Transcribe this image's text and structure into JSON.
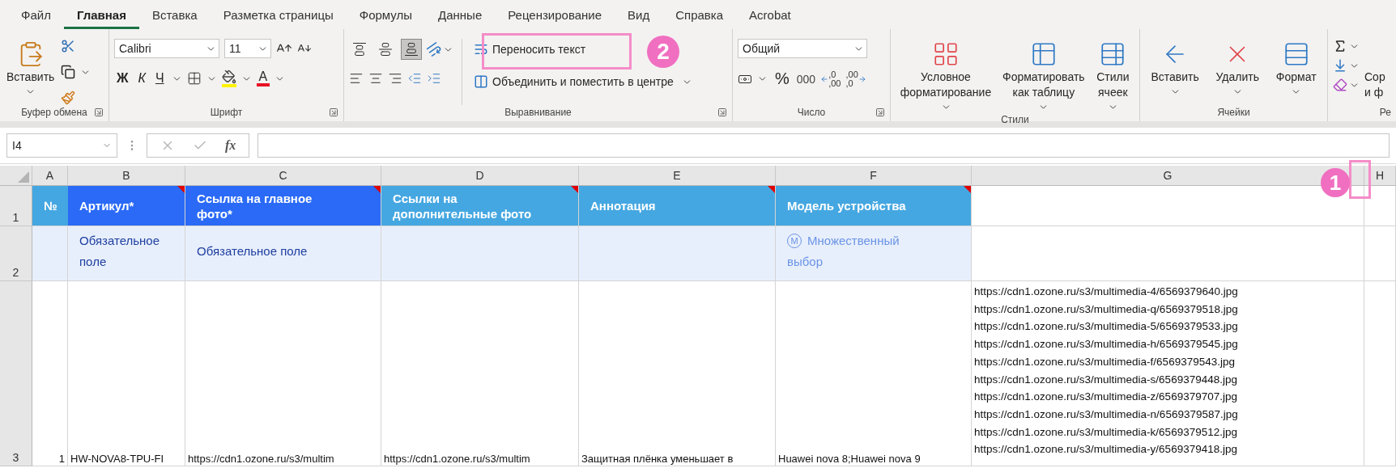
{
  "menu_tabs": [
    {
      "label": "Файл",
      "selected": false
    },
    {
      "label": "Главная",
      "selected": true
    },
    {
      "label": "Вставка",
      "selected": false
    },
    {
      "label": "Разметка страницы",
      "selected": false
    },
    {
      "label": "Формулы",
      "selected": false
    },
    {
      "label": "Данные",
      "selected": false
    },
    {
      "label": "Рецензирование",
      "selected": false
    },
    {
      "label": "Вид",
      "selected": false
    },
    {
      "label": "Справка",
      "selected": false
    },
    {
      "label": "Acrobat",
      "selected": false
    }
  ],
  "clipboard": {
    "paste_label": "Вставить",
    "group_label": "Буфер обмена"
  },
  "font": {
    "family": "Calibri",
    "size": "11",
    "bold": "Ж",
    "italic": "К",
    "underline": "Ч",
    "color_letter": "A",
    "group_label": "Шрифт"
  },
  "alignment": {
    "vertical": [
      {
        "selected": false
      },
      {
        "selected": false
      },
      {
        "selected": true
      }
    ],
    "wrap_text": "Переносить текст",
    "merge": "Объединить и поместить в центре",
    "group_label": "Выравнивание"
  },
  "number": {
    "format": "Общий",
    "percent": "%",
    "thousands": "000",
    "decimals": [
      {
        "top": ",0",
        "bottom": ",00"
      },
      {
        "top": ",00",
        "bottom": ",0"
      }
    ],
    "group_label": "Число"
  },
  "styles": {
    "buttons": [
      {
        "label": "Условное форматирование"
      },
      {
        "label": "Форматировать как таблицу"
      },
      {
        "label": "Стили ячеек"
      }
    ],
    "group_label": "Стили"
  },
  "cells": {
    "buttons": [
      "Вставить",
      "Удалить",
      "Формат"
    ],
    "group_label": "Ячейки"
  },
  "editing": {
    "sort_lines": [
      "Сор",
      "и ф"
    ],
    "group_label": "Ре"
  },
  "formula_bar": {
    "name_box": "I4",
    "fx": "fx"
  },
  "sheet": {
    "columns": [
      "A",
      "B",
      "C",
      "D",
      "E",
      "F",
      "G",
      "H"
    ],
    "rows": [
      {
        "number": "1",
        "cells": [
          {
            "text": "№",
            "color": "#45a7e1",
            "comment": false
          },
          {
            "text": "Артикул*",
            "color": "#2a6af6",
            "comment": true
          },
          {
            "text": "Ссылка на главное фото*",
            "color": "#2a6af6",
            "comment": true
          },
          {
            "text": "Ссылки на дополнительные фото",
            "color": "#45a7e1",
            "comment": true
          },
          {
            "text": "Аннотация",
            "color": "#45a7e1",
            "comment": true
          },
          {
            "text": "Модель устройства",
            "color": "#45a7e1",
            "comment": true
          },
          {},
          {}
        ]
      },
      {
        "number": "2",
        "cells": [
          {
            "color": "#e8effc"
          },
          {
            "text": "Обязательное поле",
            "color": "#e8effc",
            "kind": "required"
          },
          {
            "text": "Обязательное поле",
            "color": "#e8effc",
            "kind": "required"
          },
          {
            "color": "#e8effc"
          },
          {
            "color": "#e8effc"
          },
          {
            "text": "Множественный выбор",
            "badge": "M",
            "color": "#e8effc",
            "kind": "multi"
          },
          {},
          {}
        ]
      },
      {
        "number": "3",
        "cells": [
          {
            "text": "1",
            "kind": "number"
          },
          {
            "text": "HW-NOVA8-TPU-FI"
          },
          {
            "text": "https://cdn1.ozone.ru/s3/multim"
          },
          {
            "text": "https://cdn1.ozone.ru/s3/multim"
          },
          {
            "text": "Защитная плёнка уменьшает в"
          },
          {
            "text": "Huawei nova 8;Huawei nova 9"
          },
          {
            "lines": [
              "https://cdn1.ozone.ru/s3/multimedia-4/6569379640.jpg",
              "https://cdn1.ozone.ru/s3/multimedia-q/6569379518.jpg",
              "https://cdn1.ozone.ru/s3/multimedia-5/6569379533.jpg",
              "https://cdn1.ozone.ru/s3/multimedia-h/6569379545.jpg",
              "https://cdn1.ozone.ru/s3/multimedia-f/6569379543.jpg",
              "https://cdn1.ozone.ru/s3/multimedia-s/6569379448.jpg",
              "https://cdn1.ozone.ru/s3/multimedia-z/6569379707.jpg",
              "https://cdn1.ozone.ru/s3/multimedia-n/6569379587.jpg",
              "https://cdn1.ozone.ru/s3/multimedia-k/6569379512.jpg",
              "https://cdn1.ozone.ru/s3/multimedia-y/6569379418.jpg"
            ]
          },
          {}
        ]
      }
    ]
  },
  "annotations": [
    {
      "number": "1"
    },
    {
      "number": "2"
    }
  ]
}
